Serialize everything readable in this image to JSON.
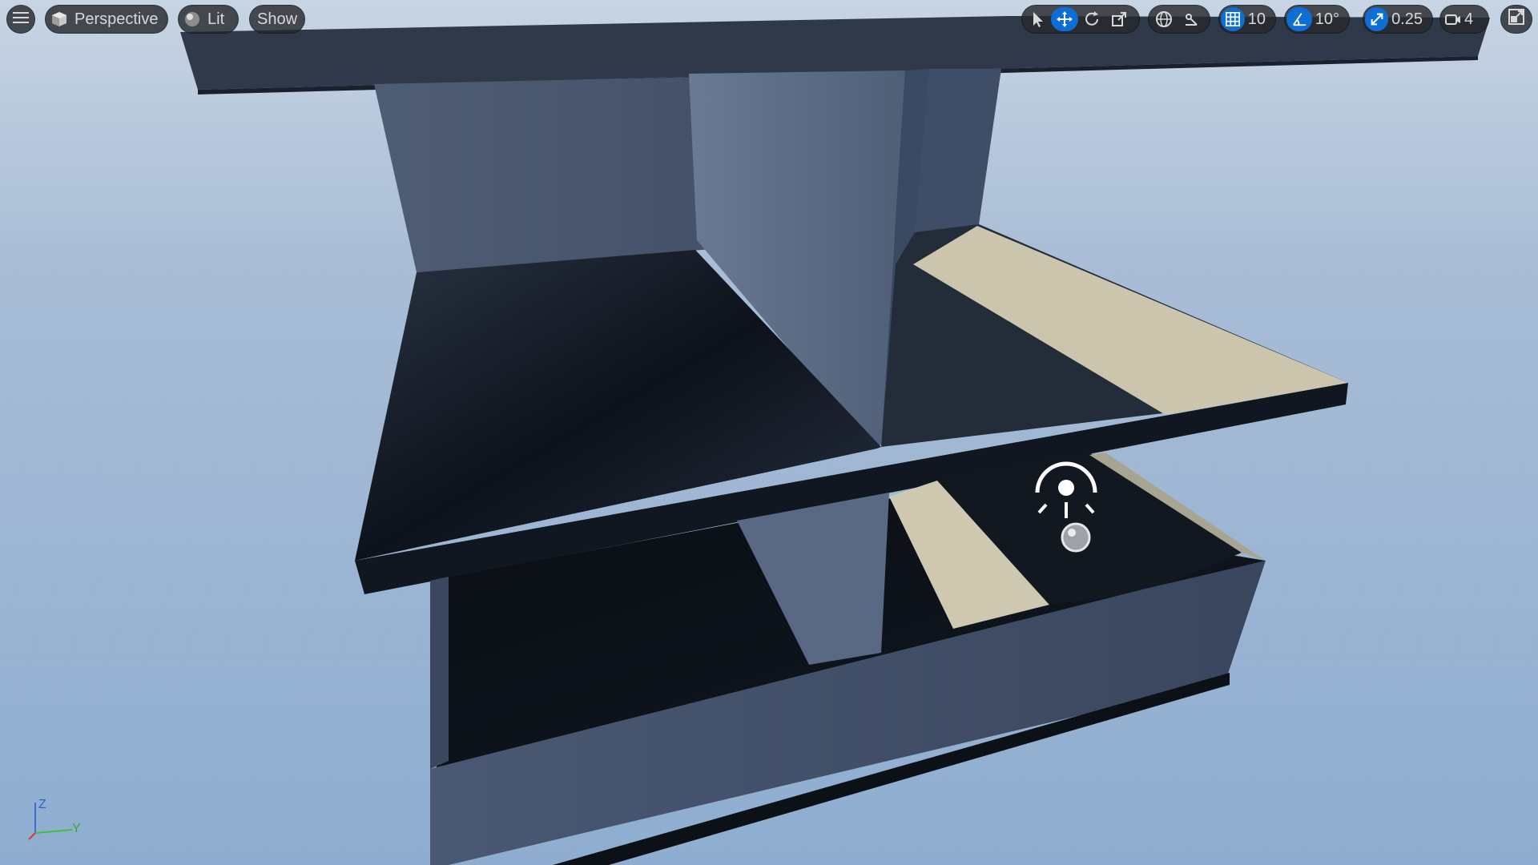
{
  "viewport": {
    "view_mode_label": "Perspective",
    "lighting_label": "Lit",
    "show_label": "Show",
    "icons": {
      "menu": "hamburger-menu-icon",
      "perspective": "cube-icon",
      "lit": "sphere-lit-icon",
      "select": "cursor-arrow-icon",
      "translate": "move-arrows-icon",
      "rotate": "rotate-icon",
      "scale": "scale-icon",
      "world_local": "globe-icon",
      "surface_snap": "surface-snap-icon",
      "grid_snap": "grid-icon",
      "angle_snap": "angle-icon",
      "scale_snap": "scale-snap-icon",
      "camera_speed": "camera-icon",
      "maximize": "maximize-viewport-icon"
    },
    "grid_snap_value": "10",
    "rotation_snap_value": "10°",
    "scale_snap_value": "0.25",
    "camera_speed_value": "4",
    "axis": {
      "z": "Z",
      "y": "Y"
    }
  },
  "colors": {
    "sky": "#9fb6d3",
    "toolbar_bg": "#26292e",
    "accent_blue": "#0f6ed6",
    "shelf_dark": "#1f2835",
    "wall_light": "#5a6a82",
    "sunlit": "#cdc6ae"
  }
}
